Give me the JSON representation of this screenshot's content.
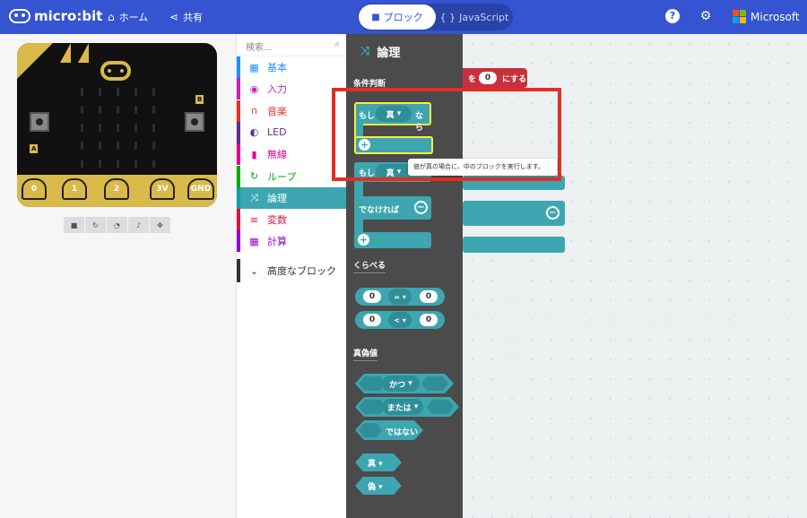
{
  "header": {
    "logo_text": "micro:bit",
    "home_label": "ホーム",
    "share_label": "共有",
    "blocks_tab_label": "ブロック",
    "js_tab_label": "JavaScript",
    "microsoft_label": "Microsoft",
    "colors": {
      "bar": "#3454d1"
    }
  },
  "simulator": {
    "pin_labels": [
      "0",
      "1",
      "2",
      "3V",
      "GND"
    ],
    "button_a": "A",
    "button_b": "B"
  },
  "toolbox": {
    "search_placeholder": "検索...",
    "categories": [
      {
        "label": "基本",
        "color": "#1e90ff",
        "icon": "grid-icon"
      },
      {
        "label": "入力",
        "color": "#c724b1",
        "icon": "target-icon"
      },
      {
        "label": "音楽",
        "color": "#e63022",
        "icon": "headphones-icon"
      },
      {
        "label": "LED",
        "color": "#5c2d91",
        "icon": "toggle-icon"
      },
      {
        "label": "無線",
        "color": "#e3008c",
        "icon": "signal-icon"
      },
      {
        "label": "ループ",
        "color": "#00aa00",
        "icon": "refresh-icon"
      },
      {
        "label": "論理",
        "color": "#00a4a6",
        "icon": "shuffle-icon"
      },
      {
        "label": "変数",
        "color": "#dc143c",
        "icon": "list-icon"
      },
      {
        "label": "計算",
        "color": "#9400d3",
        "icon": "calculator-icon"
      }
    ],
    "advanced_label": "高度なブロック"
  },
  "flyout": {
    "title": "論理",
    "section_conditional": "条件判断",
    "section_compare": "くらべる",
    "section_boolean": "真偽値",
    "if_label": "もし",
    "then_label": "なら",
    "true_label": "真",
    "false_label": "偽",
    "else_label": "でなければ",
    "op_eq": "=",
    "op_lt": "<",
    "num_zero": "0",
    "and_label": "かつ",
    "or_label": "または",
    "not_label": "ではない"
  },
  "workspace": {
    "set_block_prefix": "を",
    "set_block_value": "0",
    "set_block_suffix": "にする"
  },
  "tooltip": {
    "text": "値が真の場合に、中のブロックを実行します。"
  }
}
